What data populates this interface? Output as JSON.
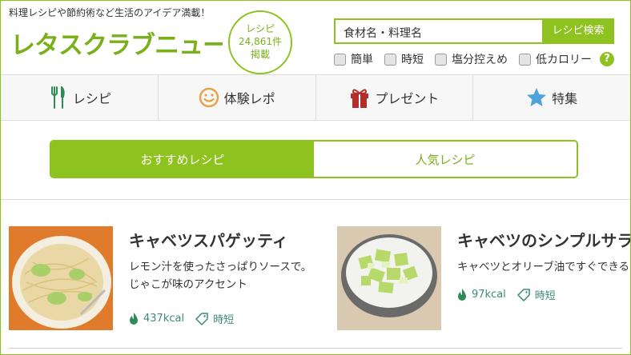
{
  "header": {
    "tagline": "料理レシピや節約術など生活のアイデア満載！",
    "logo_text": "レタスクラブニュース",
    "count_badge": {
      "line1": "レシピ",
      "line2": "24,861件",
      "line3": "掲載"
    },
    "search": {
      "placeholder": "食材名・料理名",
      "button_label": "レシピ検索"
    },
    "filters": [
      {
        "label": "簡単",
        "checked": false
      },
      {
        "label": "時短",
        "checked": false
      },
      {
        "label": "塩分控えめ",
        "checked": false
      },
      {
        "label": "低カロリー",
        "checked": false
      }
    ],
    "help_label": "?"
  },
  "nav": {
    "items": [
      {
        "label": "レシピ",
        "icon": "fork-knife-icon"
      },
      {
        "label": "体験レポ",
        "icon": "smiley-icon"
      },
      {
        "label": "プレゼント",
        "icon": "gift-icon"
      },
      {
        "label": "特集",
        "icon": "star-icon"
      }
    ]
  },
  "tabs": [
    {
      "label": "おすすめレシピ",
      "active": true
    },
    {
      "label": "人気レシピ",
      "active": false
    }
  ],
  "recipes": [
    {
      "title": "キャベツスパゲッティ",
      "desc_line1": "レモン汁を使ったさっぱりソースで。",
      "desc_line2": "じゃこが味のアクセント",
      "kcal": "437kcal",
      "tag": "時短"
    },
    {
      "title": "キャベツのシンプルサラダ",
      "desc_line1": "キャベツとオリーブ油ですぐできる",
      "desc_line2": "",
      "kcal": "97kcal",
      "tag": "時短"
    }
  ],
  "colors": {
    "accent": "#8dc21f",
    "meta": "#3a8a7a"
  }
}
